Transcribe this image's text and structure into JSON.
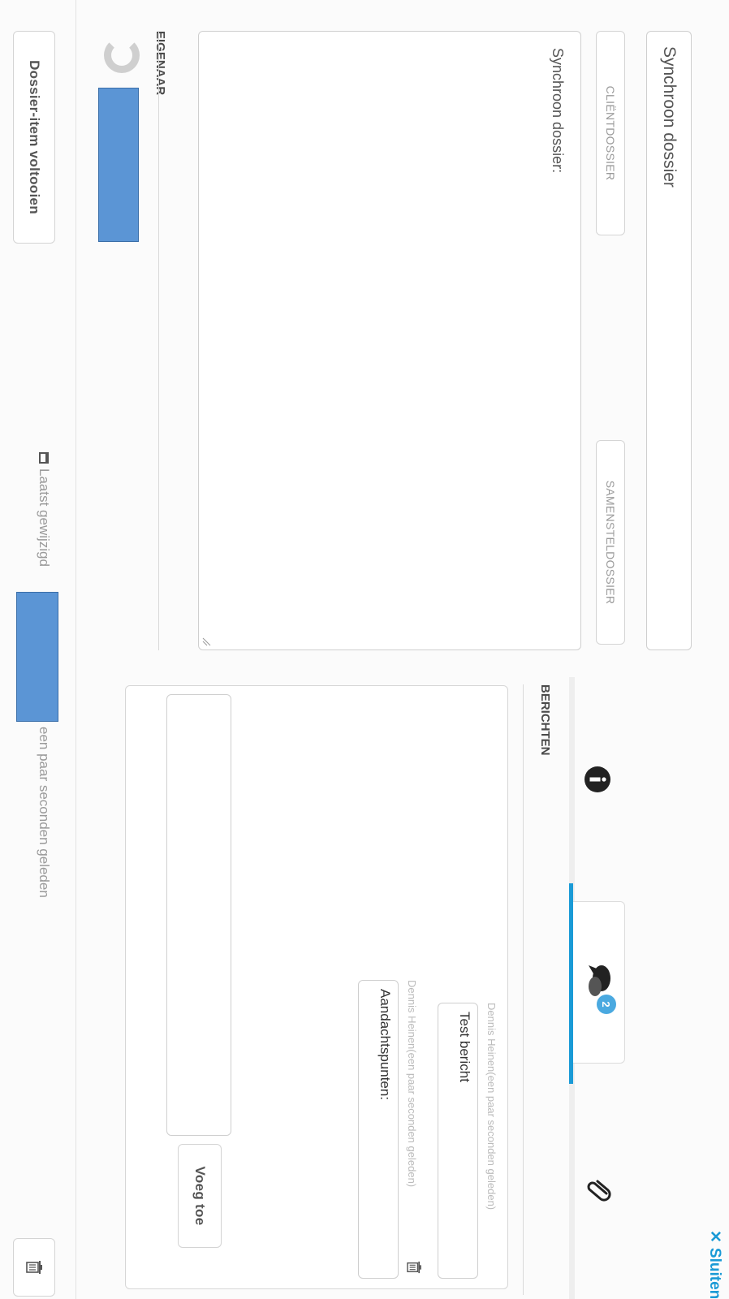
{
  "header": {
    "close_label": "Sluiten",
    "close_icon": "✕"
  },
  "form": {
    "title_value": "Synchroon dossier",
    "tab_client": "CLIËNTDOSSIER",
    "tab_composite": "SAMENSTELDOSSIER",
    "description_value": "Synchroon dossier:"
  },
  "owner": {
    "heading": "EIGENAAR"
  },
  "side_tabs": {
    "active_index": 1,
    "badge_count": "2"
  },
  "messages": {
    "heading": "BERICHTEN",
    "items": [
      {
        "author": "Dennis Heinen(een paar seconden geleden)",
        "text": "Test bericht"
      },
      {
        "author": "Dennis Heinen(een paar seconden geleden)",
        "text": "Aandachtspunten:"
      }
    ],
    "input_value": "",
    "add_label": "Voeg toe"
  },
  "footer": {
    "complete_label": "Dossier-item voltooien",
    "last_modified_prefix": "Laatst gewijzigd",
    "last_modified_suffix": "een paar seconden geleden"
  },
  "colors": {
    "accent": "#1a9ad6",
    "placeholder_block": "#5b95d5"
  }
}
